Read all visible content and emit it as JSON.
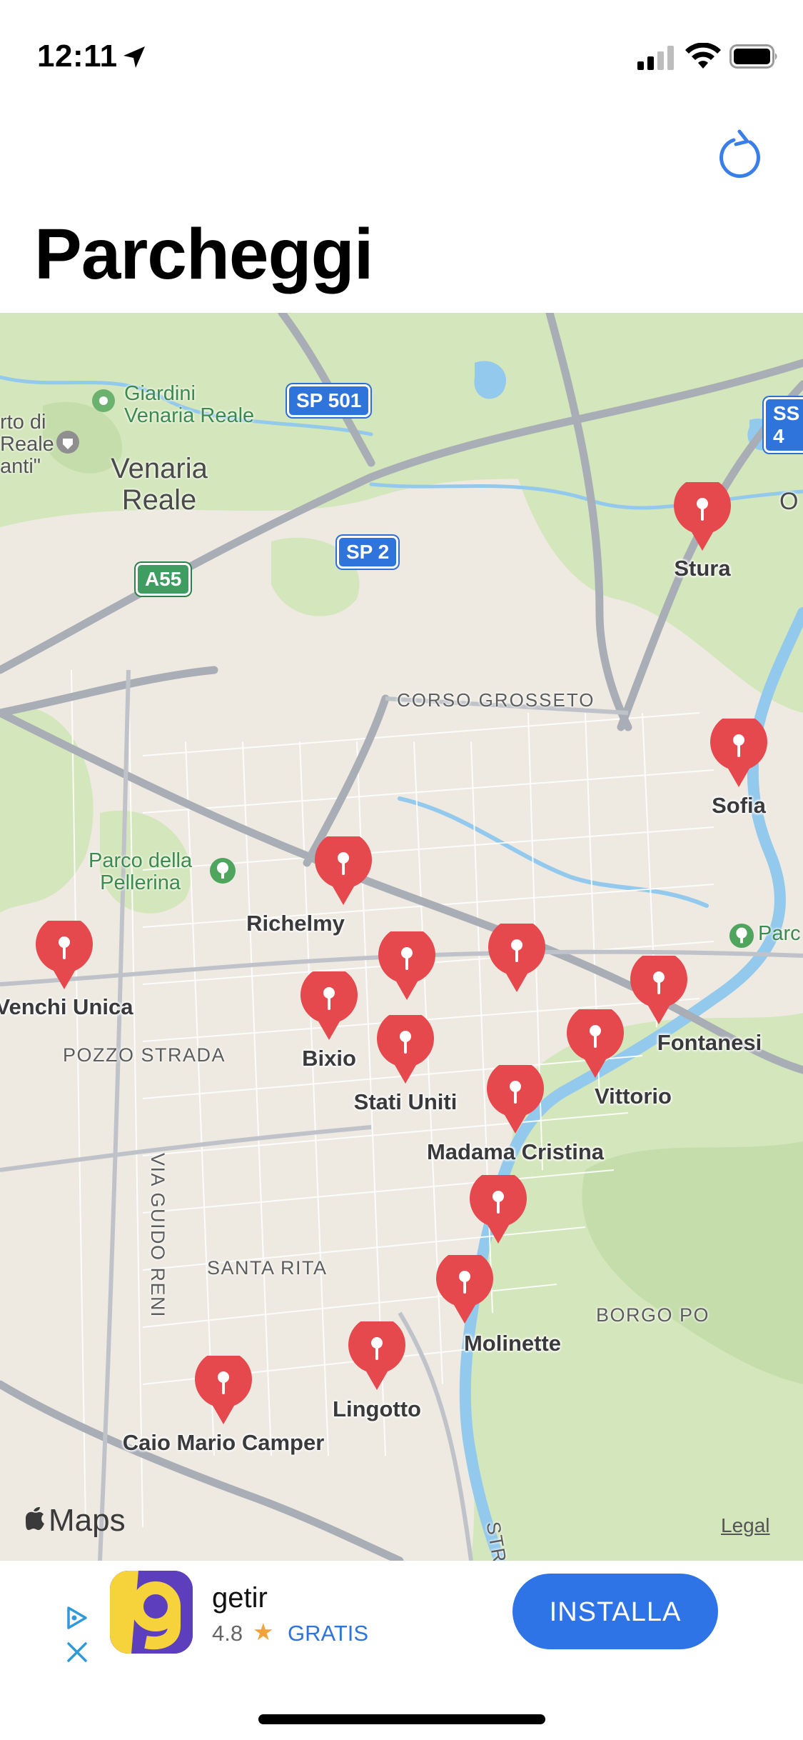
{
  "status_bar": {
    "time": "12:11"
  },
  "nav": {
    "title": "Parcheggi"
  },
  "map": {
    "markers": [
      {
        "name": "Stura"
      },
      {
        "name": "Sofia"
      },
      {
        "name": "Richelmy"
      },
      {
        "name": "Venchi Unica"
      },
      {
        "name": ""
      },
      {
        "name": ""
      },
      {
        "name": "Bixio"
      },
      {
        "name": "Stati Uniti"
      },
      {
        "name": "Fontanesi"
      },
      {
        "name": "Vittorio"
      },
      {
        "name": "Madama Cristina"
      },
      {
        "name": ""
      },
      {
        "name": "Molinette"
      },
      {
        "name": "Lingotto"
      },
      {
        "name": "Caio Mario Camper"
      }
    ],
    "labels": {
      "venaria": "Venaria\nReale",
      "giardini": "Giardini\nVenaria Reale",
      "castello": "rto di\nReale\nanti\"",
      "corso_grosseto": "CORSO GROSSETO",
      "parco_pellerina": "Parco della\nPellerina",
      "parco_right": "Parc",
      "pozzo_strada": "POZZO STRADA",
      "santa_rita": "SANTA RITA",
      "borgo_po": "BORGO PO",
      "via_guido_reni": "VIA GUIDO RENI",
      "str": "STR",
      "edge_o": "O"
    },
    "shields": {
      "sp501": "SP 501",
      "sp2": "SP 2",
      "a55": "A55",
      "ss": "SS 4"
    },
    "attribution": "Maps",
    "legal": "Legal"
  },
  "ad": {
    "app_name": "getir",
    "rating": "4.8",
    "price": "GRATIS",
    "install_label": "INSTALLA"
  },
  "colors": {
    "pin": "#e5484d",
    "accent": "#2f74e6",
    "water": "#8cc8ec",
    "park": "#cfe5b7"
  }
}
